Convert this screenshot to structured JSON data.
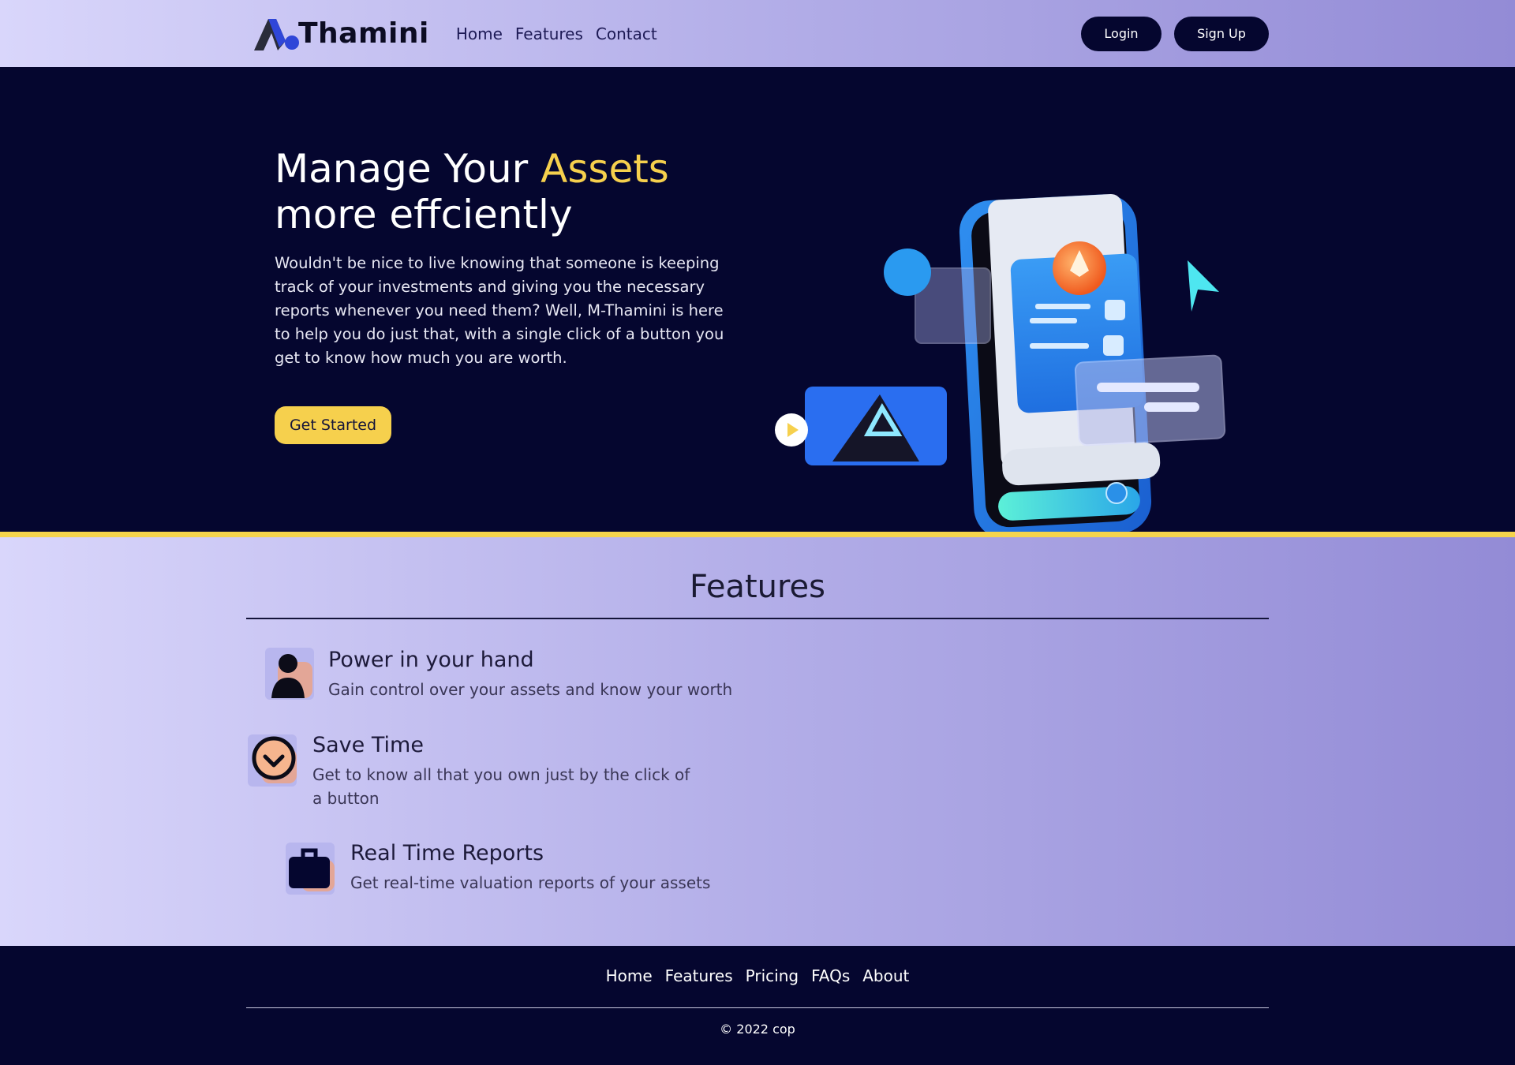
{
  "brand": {
    "name": "Thamini",
    "logo_icon": "logo-mark-icon"
  },
  "nav": {
    "links": [
      "Home",
      "Features",
      "Contact"
    ],
    "login_label": "Login",
    "signup_label": "Sign Up"
  },
  "hero": {
    "title_part1": "Manage Your ",
    "title_accent": "Assets",
    "title_part2": "more effciently",
    "description": "Wouldn't be nice to live knowing that someone is keeping track of your investments and giving you the necessary reports whenever you need them? Well, M-Thamini is here to help you do just that, with a single click of a button you get to know how much you are worth.",
    "cta_label": "Get Started",
    "illustration": "phone-wallet-illustration"
  },
  "features": {
    "title": "Features",
    "items": [
      {
        "title": "Power in your hand",
        "description": "Gain control over your assets and know your worth",
        "icon": "person-icon"
      },
      {
        "title": "Save Time",
        "description": "Get to know all that you own just by the click of a button",
        "icon": "check-circle-icon"
      },
      {
        "title": "Real Time Reports",
        "description": "Get real-time valuation reports of your assets",
        "icon": "briefcase-icon"
      }
    ]
  },
  "footer": {
    "links": [
      "Home",
      "Features",
      "Pricing",
      "FAQs",
      "About"
    ],
    "copyright": "© 2022 cop"
  },
  "colors": {
    "navy": "#05062f",
    "accent_yellow": "#f6d04d",
    "gradient_light": "#d9d6fb",
    "gradient_dark": "#938bd6"
  }
}
